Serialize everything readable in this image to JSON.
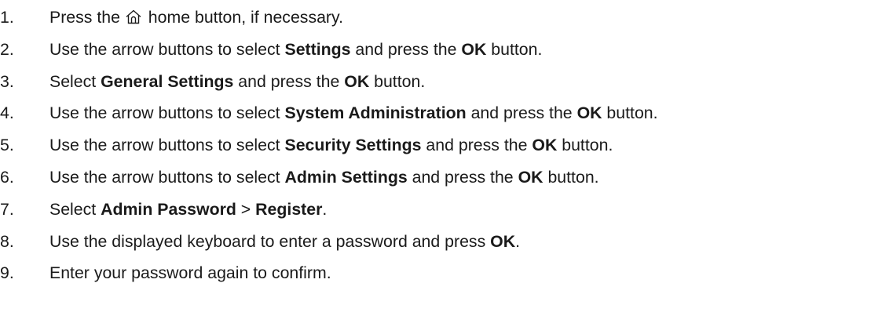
{
  "steps": [
    {
      "number": "1.",
      "parts": [
        {
          "t": "Press the "
        },
        {
          "icon": "home-icon"
        },
        {
          "t": " home button, if necessary."
        }
      ]
    },
    {
      "number": "2.",
      "parts": [
        {
          "t": "Use the arrow buttons to select "
        },
        {
          "t": "Settings",
          "b": true
        },
        {
          "t": " and press the "
        },
        {
          "t": "OK",
          "b": true
        },
        {
          "t": " button."
        }
      ]
    },
    {
      "number": "3.",
      "parts": [
        {
          "t": "Select "
        },
        {
          "t": "General Settings",
          "b": true
        },
        {
          "t": " and press the "
        },
        {
          "t": "OK",
          "b": true
        },
        {
          "t": " button."
        }
      ]
    },
    {
      "number": "4.",
      "parts": [
        {
          "t": "Use the arrow buttons to select "
        },
        {
          "t": "System Administration",
          "b": true
        },
        {
          "t": " and press the "
        },
        {
          "t": "OK",
          "b": true
        },
        {
          "t": " button."
        }
      ]
    },
    {
      "number": "5.",
      "parts": [
        {
          "t": "Use the arrow buttons to select "
        },
        {
          "t": "Security Settings",
          "b": true
        },
        {
          "t": " and press the "
        },
        {
          "t": "OK",
          "b": true
        },
        {
          "t": " button."
        }
      ]
    },
    {
      "number": "6.",
      "parts": [
        {
          "t": "Use the arrow buttons to select "
        },
        {
          "t": "Admin Settings",
          "b": true
        },
        {
          "t": " and press the "
        },
        {
          "t": "OK",
          "b": true
        },
        {
          "t": " button."
        }
      ]
    },
    {
      "number": "7.",
      "parts": [
        {
          "t": "Select "
        },
        {
          "t": "Admin Password",
          "b": true
        },
        {
          "t": " > "
        },
        {
          "t": "Register",
          "b": true
        },
        {
          "t": "."
        }
      ]
    },
    {
      "number": "8.",
      "parts": [
        {
          "t": "Use the displayed keyboard to enter a password and press "
        },
        {
          "t": "OK",
          "b": true
        },
        {
          "t": "."
        }
      ]
    },
    {
      "number": "9.",
      "parts": [
        {
          "t": "Enter your password again to confirm."
        }
      ]
    }
  ]
}
